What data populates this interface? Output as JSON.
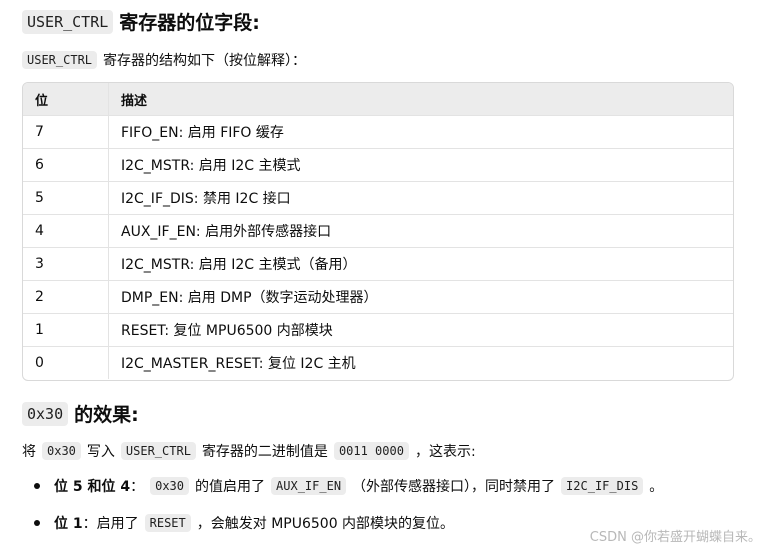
{
  "section1": {
    "code": "USER_CTRL",
    "title": "寄存器的位字段:"
  },
  "intro": {
    "code": "USER_CTRL",
    "text": "寄存器的结构如下（按位解释）："
  },
  "table": {
    "headers": [
      "位",
      "描述"
    ],
    "rows": [
      [
        "7",
        "FIFO_EN: 启用 FIFO 缓存"
      ],
      [
        "6",
        "I2C_MSTR: 启用 I2C 主模式"
      ],
      [
        "5",
        "I2C_IF_DIS: 禁用 I2C 接口"
      ],
      [
        "4",
        "AUX_IF_EN: 启用外部传感器接口"
      ],
      [
        "3",
        "I2C_MSTR: 启用 I2C 主模式（备用）"
      ],
      [
        "2",
        "DMP_EN: 启用 DMP（数字运动处理器）"
      ],
      [
        "1",
        "RESET: 复位 MPU6500 内部模块"
      ],
      [
        "0",
        "I2C_MASTER_RESET: 复位 I2C 主机"
      ]
    ]
  },
  "section2": {
    "code": "0x30",
    "title": "的效果:"
  },
  "para2": {
    "t1": "将",
    "c1": "0x30",
    "t2": "写入",
    "c2": "USER_CTRL",
    "t3": "寄存器的二进制值是",
    "c3": "0011 0000",
    "t4": "，这表示:"
  },
  "bullets": [
    {
      "bold": "位 5 和位 4",
      "t1": "：",
      "c1": "0x30",
      "t2": "的值启用了",
      "c2": "AUX_IF_EN",
      "t3": "（外部传感器接口），同时禁用了",
      "c3": "I2C_IF_DIS",
      "t4": "。"
    },
    {
      "bold": "位 1",
      "t1": "：启用了",
      "c1": "RESET",
      "t2": "，会触发对 MPU6500 内部模块的复位。"
    }
  ],
  "watermark": "CSDN @你若盛开蝴蝶自来。"
}
